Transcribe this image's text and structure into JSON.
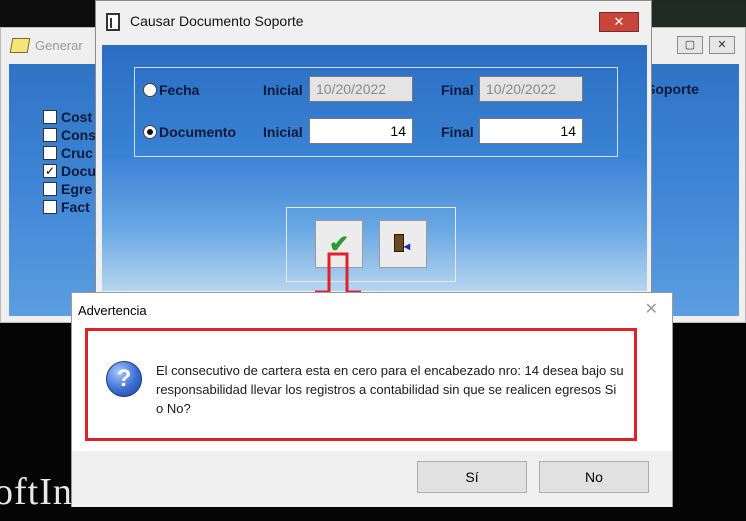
{
  "background_window": {
    "title": "Generar",
    "right_label": "Soporte",
    "controls": [
      "▢",
      "✕"
    ],
    "checkboxes": [
      {
        "label": "Cost",
        "checked": false
      },
      {
        "label": "Cons",
        "checked": false
      },
      {
        "label": "Cruc",
        "checked": false
      },
      {
        "label": "Docu",
        "checked": true
      },
      {
        "label": "Egre",
        "checked": false
      },
      {
        "label": "Fact",
        "checked": false
      }
    ]
  },
  "main_window": {
    "title": "Causar Documento Soporte",
    "close_glyph": "✕",
    "fecha": {
      "label": "Fecha",
      "inicial_label": "Inicial",
      "inicial_value": "10/20/2022",
      "final_label": "Final",
      "final_value": "10/20/2022",
      "selected": false
    },
    "documento": {
      "label": "Documento",
      "inicial_label": "Inicial",
      "inicial_value": "14",
      "final_label": "Final",
      "final_value": "14",
      "selected": true
    },
    "accept_glyph": "✔"
  },
  "advertencia_dialog": {
    "title": "Advertencia",
    "close_glyph": "✕",
    "icon_glyph": "?",
    "message": "El consecutivo de cartera esta en cero para el encabezado nro: 14 desea bajo su responsabilidad llevar los registros a contabilidad sin que se realicen egresos Si o No?",
    "yes_label": "Sí",
    "no_label": "No"
  },
  "desktop_text": "oftIn",
  "colors": {
    "accent_red": "#e0202a",
    "panel_blue": "#3a82d4"
  }
}
